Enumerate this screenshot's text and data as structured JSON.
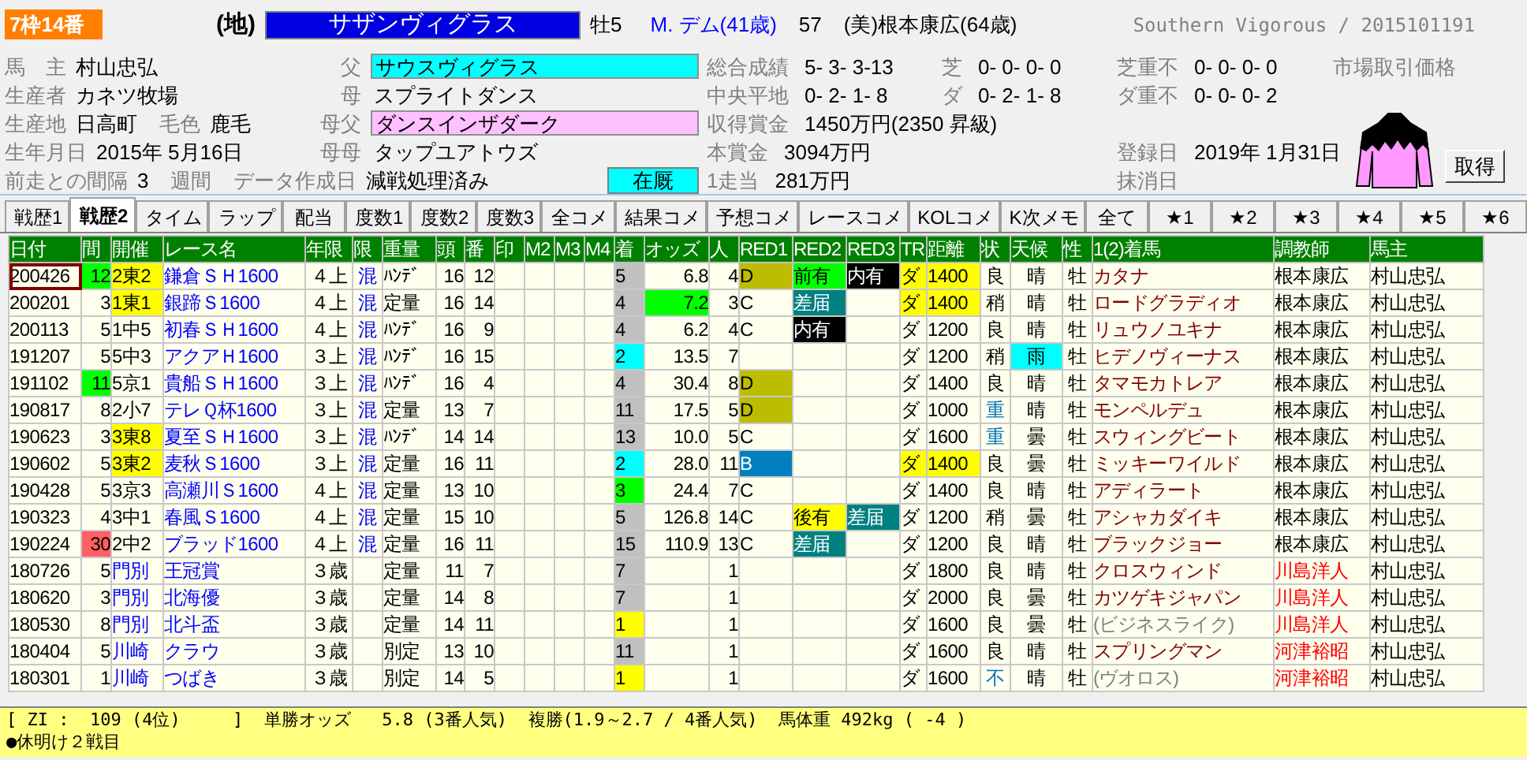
{
  "horse": {
    "frame_badge": "7枠14番",
    "region": "(地)",
    "name": "サザンヴィグラス",
    "sex_age": "牡5",
    "jockey": "M. デム(41歳)",
    "weight": "57",
    "trainer": "(美)根本康広(64歳)",
    "english": "Southern Vigorous / 2015101191"
  },
  "info_rows": [
    {
      "left": [
        {
          "label": "馬　主",
          "value": "村山忠弘"
        }
      ],
      "pedigree": {
        "label": "父",
        "value": "サウスヴィグラス",
        "color": "#00ffff"
      },
      "stats": [
        {
          "kind": "record",
          "label": "総合成績",
          "value": "5- 3- 3-13"
        },
        {
          "kind": "record",
          "label": "芝",
          "value": "0- 0- 0- 0"
        },
        {
          "kind": "record",
          "label": "芝重不",
          "value": "0- 0- 0- 0"
        },
        {
          "kind": "note",
          "label": "市場取引価格"
        }
      ]
    },
    {
      "left": [
        {
          "label": "生産者",
          "value": "カネツ牧場"
        }
      ],
      "pedigree": {
        "label": "母",
        "value": "スプライトダンス"
      },
      "stats": [
        {
          "kind": "record",
          "label": "中央平地",
          "value": "0- 2- 1- 8"
        },
        {
          "kind": "record",
          "label": "ダ",
          "value": "0- 2- 1- 8"
        },
        {
          "kind": "record",
          "label": "ダ重不",
          "value": "0- 0- 0- 2"
        }
      ]
    },
    {
      "left": [
        {
          "label": "生産地",
          "value": "日高町"
        },
        {
          "label": "毛色",
          "value": "鹿毛"
        }
      ],
      "pedigree": {
        "label": "母父",
        "value": "ダンスインザダーク",
        "color": "#ffc0ff"
      },
      "stats": [
        {
          "kind": "money",
          "label": "収得賞金",
          "value": "1450万円(2350 昇級)"
        }
      ]
    },
    {
      "left": [
        {
          "label": "生年月日",
          "value": "2015年 5月16日"
        }
      ],
      "pedigree": {
        "label": "母母",
        "value": "タップユアトウズ"
      },
      "stats": [
        {
          "kind": "money",
          "label": "本賞金",
          "value": "3094万円"
        },
        {
          "kind": "date",
          "label": "登録日",
          "value": "2019年 1月31日"
        }
      ]
    },
    {
      "left": [
        {
          "label": "前走との間隔",
          "value": "3"
        },
        {
          "label": "週間"
        },
        {
          "label": "データ作成日",
          "value": "減戦処理済み"
        }
      ],
      "status": {
        "text": "在厩",
        "color": "#00ffff"
      },
      "stats": [
        {
          "kind": "money",
          "label": "1走当",
          "value": "281万円"
        },
        {
          "kind": "date",
          "label": "抹消日"
        }
      ]
    }
  ],
  "get_button": "取得",
  "tabs": [
    {
      "label": "戦歴1",
      "selected": false
    },
    {
      "label": "戦歴2",
      "selected": true
    },
    {
      "label": "タイム",
      "selected": false
    },
    {
      "label": "ラップ",
      "selected": false
    },
    {
      "label": "配当",
      "selected": false
    },
    {
      "label": "度数1",
      "selected": false
    },
    {
      "label": "度数2",
      "selected": false
    },
    {
      "label": "度数3",
      "selected": false
    },
    {
      "label": "全コメ",
      "selected": false
    },
    {
      "label": "結果コメ",
      "selected": false
    },
    {
      "label": "予想コメ",
      "selected": false
    },
    {
      "label": "レースコメ",
      "selected": false
    },
    {
      "label": "KOLコメ",
      "selected": false
    },
    {
      "label": "K次メモ",
      "selected": false
    },
    {
      "label": "全て",
      "selected": false
    },
    {
      "label": "★1",
      "selected": false
    },
    {
      "label": "★2",
      "selected": false
    },
    {
      "label": "★3",
      "selected": false
    },
    {
      "label": "★4",
      "selected": false
    },
    {
      "label": "★5",
      "selected": false
    },
    {
      "label": "★6",
      "selected": false
    }
  ],
  "table": {
    "columns": [
      "日付",
      "間",
      "開催",
      "レース名",
      "年限",
      "限",
      "重量",
      "頭",
      "番",
      "印",
      "M2",
      "M3",
      "M4",
      "着",
      "オッズ",
      "人",
      "RED1",
      "RED2",
      "RED3",
      "TR",
      "距離",
      "状",
      "天候",
      "性",
      "1(2)着馬",
      "調教師",
      "馬主"
    ],
    "rows": [
      {
        "selected": true,
        "cells": [
          "200426",
          {
            "text": "12",
            "color": "#00ff00"
          },
          {
            "text": "2東2",
            "color": "#ffff00"
          },
          "鎌倉ＳＨ1600",
          "４上",
          "混",
          "ﾊﾝﾃﾞ",
          "16",
          "12",
          null,
          null,
          null,
          null,
          "5",
          "6.8",
          "4",
          {
            "text": "D",
            "color": "#bcbc00"
          },
          {
            "text": "前有",
            "color": "#00ff00"
          },
          {
            "text": "内有",
            "color": "#000000"
          },
          {
            "text": "ダ",
            "color": "#ffff00"
          },
          {
            "text": "1400",
            "color": "#ffff00"
          },
          "良",
          "晴",
          "牡",
          "カタナ",
          "根本康広",
          "村山忠弘"
        ]
      },
      {
        "selected": false,
        "cells": [
          "200201",
          "3",
          {
            "text": "1東1",
            "color": "#ffff00"
          },
          "銀蹄Ｓ1600",
          "４上",
          "混",
          "定量",
          "16",
          "14",
          null,
          null,
          null,
          null,
          "4",
          {
            "text": "7.2",
            "color": "#00ff00"
          },
          "3",
          "C",
          {
            "text": "差届",
            "color": "#008080"
          },
          null,
          {
            "text": "ダ",
            "color": "#ffff00"
          },
          {
            "text": "1400",
            "color": "#ffff00"
          },
          "稍",
          "晴",
          "牡",
          "ロードグラディオ",
          "根本康広",
          "村山忠弘"
        ]
      },
      {
        "selected": false,
        "cells": [
          "200113",
          "5",
          "1中5",
          "初春ＳＨ1600",
          "４上",
          "混",
          "ﾊﾝﾃﾞ",
          "16",
          "9",
          null,
          null,
          null,
          null,
          "4",
          "6.2",
          "4",
          "C",
          {
            "text": "内有",
            "color": "#000000"
          },
          null,
          "ダ",
          "1200",
          "良",
          "晴",
          "牡",
          "リュウノユキナ",
          "根本康広",
          "村山忠弘"
        ]
      },
      {
        "selected": false,
        "cells": [
          "191207",
          "5",
          "5中3",
          "アクアＨ1600",
          "３上",
          "混",
          "ﾊﾝﾃﾞ",
          "16",
          "15",
          null,
          null,
          null,
          null,
          {
            "text": "2",
            "color": "#00ffff"
          },
          "13.5",
          "7",
          null,
          null,
          null,
          "ダ",
          "1200",
          "稍",
          {
            "text": "雨",
            "color": "#00ffff"
          },
          "牡",
          "ヒデノヴィーナス",
          "根本康広",
          "村山忠弘"
        ]
      },
      {
        "selected": false,
        "cells": [
          "191102",
          {
            "text": "11",
            "color": "#00ff00"
          },
          "5京1",
          "貴船ＳＨ1600",
          "３上",
          "混",
          "ﾊﾝﾃﾞ",
          "16",
          "4",
          null,
          null,
          null,
          null,
          "4",
          "30.4",
          "8",
          {
            "text": "D",
            "color": "#bcbc00"
          },
          null,
          null,
          "ダ",
          "1400",
          "良",
          "晴",
          "牡",
          "タマモカトレア",
          "根本康広",
          "村山忠弘"
        ]
      },
      {
        "selected": false,
        "cells": [
          "190817",
          "8",
          "2小7",
          "テレＱ杯1600",
          "３上",
          "混",
          "定量",
          "13",
          "7",
          null,
          null,
          null,
          null,
          "11",
          "17.5",
          "5",
          {
            "text": "D",
            "color": "#bcbc00"
          },
          null,
          null,
          "ダ",
          "1000",
          {
            "text": "重",
            "accent": true
          },
          "晴",
          "牡",
          "モンペルデュ",
          "根本康広",
          "村山忠弘"
        ]
      },
      {
        "selected": false,
        "cells": [
          "190623",
          "3",
          {
            "text": "3東8",
            "color": "#ffff00"
          },
          "夏至ＳＨ1600",
          "３上",
          "混",
          "ﾊﾝﾃﾞ",
          "14",
          "14",
          null,
          null,
          null,
          null,
          "13",
          "10.0",
          "5",
          "C",
          null,
          null,
          "ダ",
          "1600",
          {
            "text": "重",
            "accent": true
          },
          "曇",
          "牡",
          "スウィングビート",
          "根本康広",
          "村山忠弘"
        ]
      },
      {
        "selected": false,
        "cells": [
          "190602",
          "5",
          {
            "text": "3東2",
            "color": "#ffff00"
          },
          "麦秋Ｓ1600",
          "３上",
          "混",
          "定量",
          "16",
          "11",
          null,
          null,
          null,
          null,
          {
            "text": "2",
            "color": "#00ffff"
          },
          "28.0",
          "11",
          {
            "text": "B",
            "color": "#0080c0"
          },
          null,
          null,
          {
            "text": "ダ",
            "color": "#ffff00"
          },
          {
            "text": "1400",
            "color": "#ffff00"
          },
          "良",
          "曇",
          "牡",
          "ミッキーワイルド",
          "根本康広",
          "村山忠弘"
        ]
      },
      {
        "selected": false,
        "cells": [
          "190428",
          "5",
          "3京3",
          "高瀬川Ｓ1600",
          "４上",
          "混",
          "定量",
          "13",
          "10",
          null,
          null,
          null,
          null,
          {
            "text": "3",
            "color": "#00ff00"
          },
          "24.4",
          "7",
          "C",
          null,
          null,
          "ダ",
          "1400",
          "良",
          "晴",
          "牡",
          "アディラート",
          "根本康広",
          "村山忠弘"
        ]
      },
      {
        "selected": false,
        "cells": [
          "190323",
          "4",
          "3中1",
          "春風Ｓ1600",
          "４上",
          "混",
          "定量",
          "15",
          "10",
          null,
          null,
          null,
          null,
          "5",
          "126.8",
          "14",
          "C",
          {
            "text": "後有",
            "color": "#ffff00"
          },
          {
            "text": "差届",
            "color": "#008080"
          },
          "ダ",
          "1200",
          "稍",
          "曇",
          "牡",
          "アシャカダイキ",
          "根本康広",
          "村山忠弘"
        ]
      },
      {
        "selected": false,
        "cells": [
          "190224",
          {
            "text": "30",
            "color": "#ff6060"
          },
          "2中2",
          "ブラッド1600",
          "４上",
          "混",
          "定量",
          "16",
          "11",
          null,
          null,
          null,
          null,
          "15",
          "110.9",
          "13",
          "C",
          {
            "text": "差届",
            "color": "#008080"
          },
          null,
          "ダ",
          "1200",
          "良",
          "晴",
          "牡",
          "ブラックジョー",
          "根本康広",
          "村山忠弘"
        ]
      },
      {
        "selected": false,
        "cells": [
          "180726",
          "5",
          {
            "text": "門別",
            "accent": true
          },
          "王冠賞",
          "３歳",
          null,
          "定量",
          "11",
          "7",
          null,
          null,
          null,
          null,
          "7",
          null,
          "1",
          null,
          null,
          null,
          "ダ",
          "1800",
          "良",
          "晴",
          "牡",
          "クロスウィンド",
          {
            "text": "川島洋人",
            "accent": true
          },
          "村山忠弘"
        ]
      },
      {
        "selected": false,
        "cells": [
          "180620",
          "3",
          {
            "text": "門別",
            "accent": true
          },
          "北海優",
          "３歳",
          null,
          "定量",
          "14",
          "8",
          null,
          null,
          null,
          null,
          "7",
          null,
          "1",
          null,
          null,
          null,
          "ダ",
          "2000",
          "良",
          "曇",
          "牡",
          "カツゲキジャパン",
          {
            "text": "川島洋人",
            "accent": true
          },
          "村山忠弘"
        ]
      },
      {
        "selected": false,
        "cells": [
          "180530",
          "8",
          {
            "text": "門別",
            "accent": true
          },
          "北斗盃",
          "３歳",
          null,
          "定量",
          "14",
          "11",
          null,
          null,
          null,
          null,
          {
            "text": "1",
            "color": "#ffff00"
          },
          null,
          "1",
          null,
          null,
          null,
          "ダ",
          "1600",
          "良",
          "曇",
          "牡",
          {
            "text": "(ビジネスライク)",
            "accent": true
          },
          {
            "text": "川島洋人",
            "accent": true
          },
          "村山忠弘"
        ]
      },
      {
        "selected": false,
        "cells": [
          "180404",
          "5",
          {
            "text": "川崎",
            "accent": true
          },
          "クラウ",
          "３歳",
          null,
          "別定",
          "13",
          "10",
          null,
          null,
          null,
          null,
          "11",
          null,
          "1",
          null,
          null,
          null,
          "ダ",
          "1600",
          "良",
          "晴",
          "牡",
          "スプリングマン",
          {
            "text": "河津裕昭",
            "accent": true
          },
          "村山忠弘"
        ]
      },
      {
        "selected": false,
        "cells": [
          "180301",
          "1",
          {
            "text": "川崎",
            "accent": true
          },
          "つばき",
          "３歳",
          null,
          "別定",
          "14",
          "5",
          null,
          null,
          null,
          null,
          {
            "text": "1",
            "color": "#ffff00"
          },
          null,
          "1",
          null,
          null,
          null,
          "ダ",
          "1600",
          {
            "text": "不",
            "accent": true
          },
          "晴",
          "牡",
          {
            "text": "(ヴオロス)",
            "accent": true
          },
          {
            "text": "河津裕昭",
            "accent": true
          },
          "村山忠弘"
        ]
      }
    ]
  },
  "summary": [
    "[ ZI :  109 (4位)     ]  単勝オッズ   5.8 (3番人気)  複勝(1.9～2.7 / 4番人気)  馬体重 492kg ( -4 )",
    "●休明け２戦目"
  ]
}
